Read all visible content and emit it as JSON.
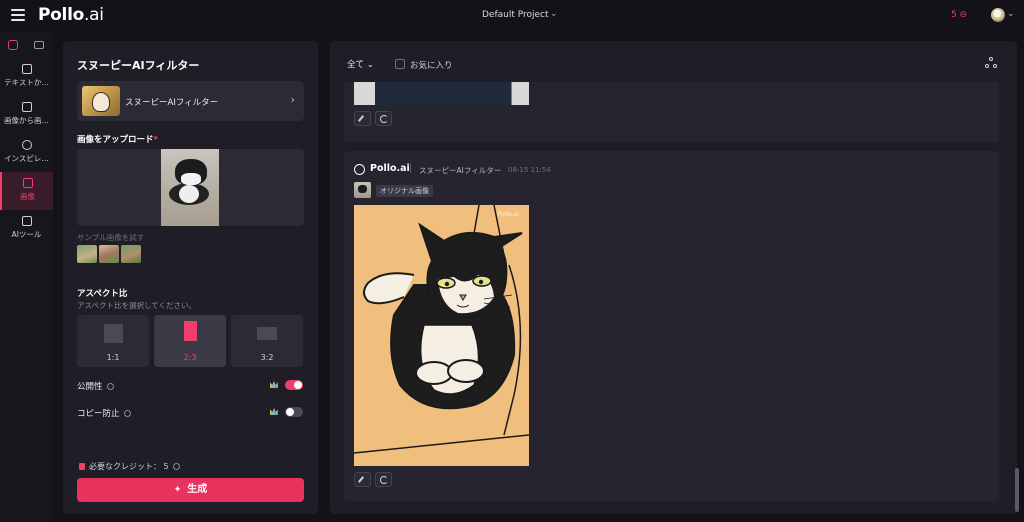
{
  "app": {
    "logo_main": "Pollo",
    "logo_suffix": ".ai",
    "project_name": "Default Project",
    "credits": "5 ⊖"
  },
  "leftnav": {
    "items": [
      {
        "label": "テキストか…",
        "icon": "text-to-image-icon"
      },
      {
        "label": "画像から画…",
        "icon": "image-to-image-icon"
      },
      {
        "label": "インスピレ…",
        "icon": "compass-icon"
      },
      {
        "label": "画像",
        "icon": "image-icon",
        "active": true
      },
      {
        "label": "AIツール",
        "icon": "toolbox-icon"
      }
    ]
  },
  "panel": {
    "title": "スヌーピーAIフィルター",
    "filter_card_name": "スヌーピーAIフィルター",
    "upload_label": "画像をアップロード",
    "required_mark": "*",
    "sample_label": "サンプル画像を試す",
    "aspect_label": "アスペクト比",
    "aspect_sub": "アスペクト比を選択してください。",
    "ratios": [
      {
        "label": "1:1",
        "selected": false
      },
      {
        "label": "2:3",
        "selected": true
      },
      {
        "label": "3:2",
        "selected": false
      }
    ],
    "public_label": "公開性",
    "public_on": true,
    "copy_protect_label": "コピー防止",
    "copy_protect_on": false,
    "credit_line": "必要なクレジット：",
    "credit_value": "5",
    "generate_label": "生成",
    "generate_icon": "sparkle-icon"
  },
  "gallery": {
    "filter_all": "全て",
    "favorites_label": "お気に入り",
    "card": {
      "brand": "Pollo.ai",
      "filter_tag": "スヌーピーAIフィルター",
      "timestamp": "08-15 11:54",
      "original_badge": "オリジナル画像",
      "watermark": "Pollo.ai"
    }
  },
  "colors": {
    "accent": "#ef3f6a",
    "background": "#131219",
    "panel": "#1f1e27"
  }
}
